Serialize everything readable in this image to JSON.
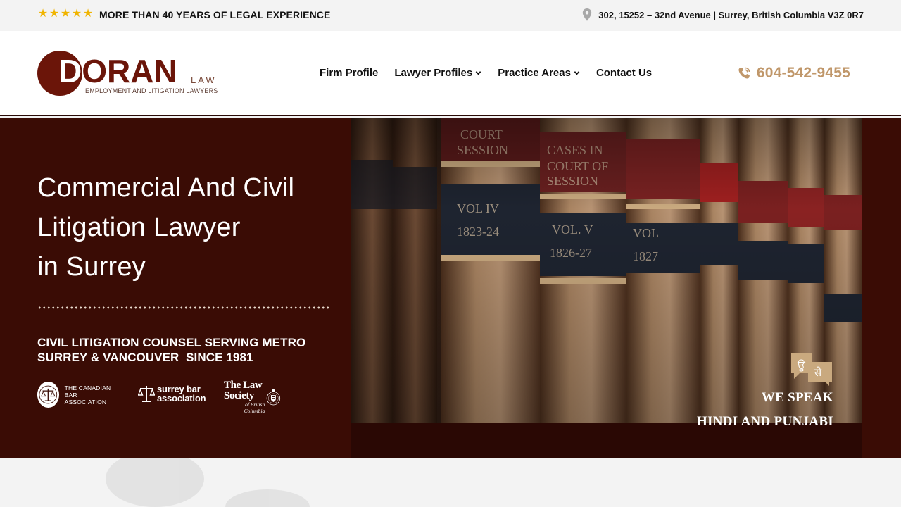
{
  "topbar": {
    "rating_stars": 5,
    "experience_text": "MORE THAN 40 YEARS OF LEGAL EXPERIENCE",
    "address": "302, 15252 – 32nd Avenue | Surrey, British Columbia V3Z 0R7",
    "star_color": "#f0b400"
  },
  "header": {
    "logo": {
      "name": "DORAN",
      "suffix": "LAW",
      "tagline": "EMPLOYMENT AND LITIGATION LAWYERS"
    },
    "nav": [
      {
        "label": "Firm Profile",
        "has_dropdown": false
      },
      {
        "label": "Lawyer Profiles",
        "has_dropdown": true
      },
      {
        "label": "Practice Areas",
        "has_dropdown": true
      },
      {
        "label": "Contact Us",
        "has_dropdown": false
      }
    ],
    "phone": "604-542-9455",
    "phone_color": "#c0976a"
  },
  "hero": {
    "title_line1": "Commercial And Civil",
    "title_line2": "Litigation Lawyer",
    "title_line3": "in Surrey",
    "subtitle_line1": "CIVIL LITIGATION COUNSEL SERVING METRO",
    "subtitle_line2": "SURREY & VANCOUVER  SINCE 1981",
    "badges": {
      "cba_line1": "THE CANADIAN",
      "cba_line2": "BAR ASSOCIATION",
      "sba_line1": "surrey bar",
      "sba_line2": "association",
      "ls_line1": "The Law Society",
      "ls_line2": "of British Columbia"
    },
    "languages": {
      "line1": "WE SPEAK",
      "line2": "HINDI AND PUNJABI",
      "glyph1": "ਊ",
      "glyph2": "से"
    },
    "background_color": "#3a0c05"
  }
}
